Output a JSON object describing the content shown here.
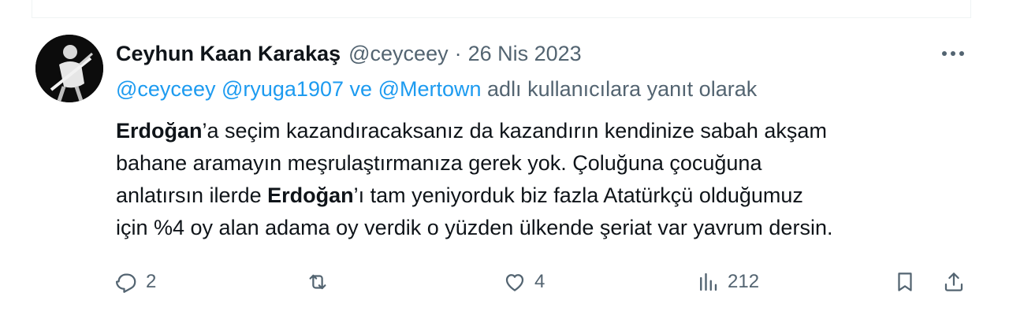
{
  "tweet": {
    "author_name": "Ceyhun Kaan Karakaş",
    "handle": "@ceyceey",
    "separator": "·",
    "date": "26 Nis 2023",
    "reply_to": {
      "mentions": [
        "@ceyceey",
        "@ryuga1907"
      ],
      "conjunction": "ve",
      "last_mention": "@Mertown",
      "suffix": "adlı kullanıcılara yanıt olarak"
    },
    "body": {
      "line1_bold": "Erdoğan",
      "line1_rest": "’a seçim kazandıracaksanız da kazandırın kendinize sabah akşam",
      "line2": "bahane aramayın meşrulaştırmanıza gerek yok. Çoluğuna çocuğuna",
      "line3_pre": "anlatırsın ilerde ",
      "line3_bold": "Erdoğan",
      "line3_rest": "’ı tam yeniyorduk biz fazla Atatürkçü olduğumuz",
      "line4": "için %4 oy alan adama oy verdik o yüzden ülkende şeriat var yavrum dersin."
    },
    "stats": {
      "replies": "2",
      "retweets": "",
      "likes": "4",
      "views": "212"
    }
  },
  "colors": {
    "text": "#0f1419",
    "secondary": "#536471",
    "accent": "#1d9bf0"
  },
  "icons": [
    "more-options-icon",
    "reply-icon",
    "retweet-icon",
    "like-icon",
    "views-icon",
    "bookmark-icon",
    "share-icon"
  ]
}
